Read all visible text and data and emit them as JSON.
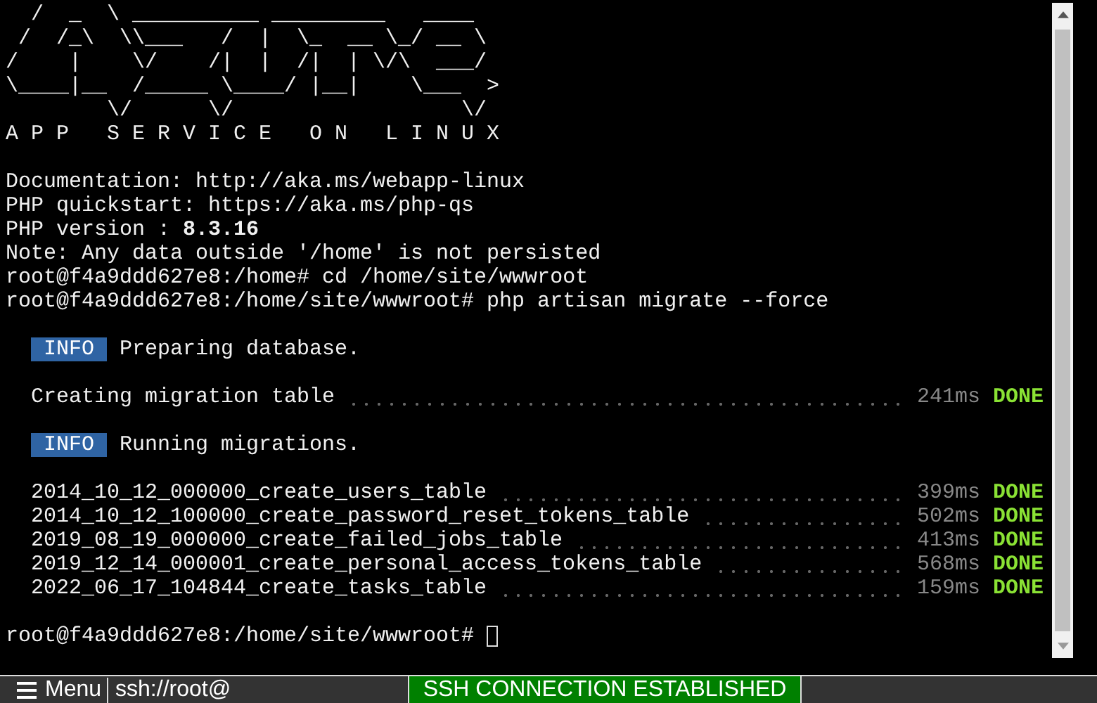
{
  "banner": {
    "art_lines": [
      "  /  _  \\ __________ _________   ____",
      " /  /_\\  \\\\___   /  |  \\_  __ \\_/ __ \\",
      "/    |    \\/    /|  |  /|  | \\/\\  ___/",
      "\\____|__  /_____ \\____/ |__|    \\___  >",
      "        \\/      \\/                  \\/"
    ],
    "subtitle": "A P P   S E R V I C E   O N   L I N U X"
  },
  "lines": [
    {
      "kind": "blank"
    },
    {
      "kind": "text",
      "text": "Documentation: http://aka.ms/webapp-linux"
    },
    {
      "kind": "text",
      "text": "PHP quickstart: https://aka.ms/php-qs"
    },
    {
      "kind": "text",
      "text": "PHP version : **8.3.16**"
    },
    {
      "kind": "text",
      "text": "Note: Any data outside '/home' is not persisted"
    },
    {
      "kind": "text",
      "text": "root@f4a9ddd627e8:/home# cd /home/site/wwwroot"
    },
    {
      "kind": "text",
      "text": "root@f4a9ddd627e8:/home/site/wwwroot# php artisan migrate --force"
    },
    {
      "kind": "blank"
    },
    {
      "kind": "info",
      "badge": "INFO",
      "text": "Preparing database."
    },
    {
      "kind": "blank"
    },
    {
      "kind": "task",
      "name": "Creating migration table",
      "time": "241ms",
      "status": "DONE"
    },
    {
      "kind": "blank"
    },
    {
      "kind": "info",
      "badge": "INFO",
      "text": "Running migrations."
    },
    {
      "kind": "blank"
    },
    {
      "kind": "task",
      "name": "2014_10_12_000000_create_users_table",
      "time": "399ms",
      "status": "DONE"
    },
    {
      "kind": "task",
      "name": "2014_10_12_100000_create_password_reset_tokens_table",
      "time": "502ms",
      "status": "DONE"
    },
    {
      "kind": "task",
      "name": "2019_08_19_000000_create_failed_jobs_table",
      "time": "413ms",
      "status": "DONE"
    },
    {
      "kind": "task",
      "name": "2019_12_14_000001_create_personal_access_tokens_table",
      "time": "568ms",
      "status": "DONE"
    },
    {
      "kind": "task",
      "name": "2022_06_17_104844_create_tasks_table",
      "time": "159ms",
      "status": "DONE"
    },
    {
      "kind": "blank"
    },
    {
      "kind": "prompt",
      "text": "root@f4a9ddd627e8:/home/site/wwwroot#"
    }
  ],
  "status_bar": {
    "menu": "Menu",
    "address": "ssh://root@",
    "connection": "SSH CONNECTION ESTABLISHED"
  }
}
